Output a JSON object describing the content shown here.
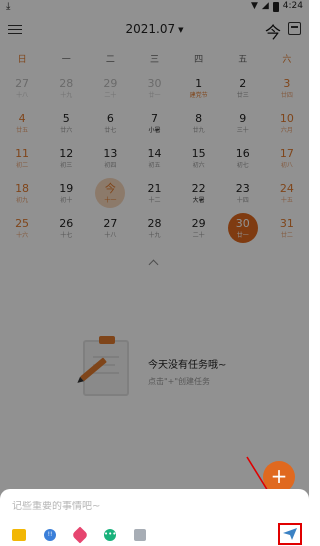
{
  "status_bar": {
    "time": "4:24"
  },
  "header": {
    "month": "2021.07",
    "today_label": "今"
  },
  "weekdays": [
    "日",
    "一",
    "二",
    "三",
    "四",
    "五",
    "六"
  ],
  "calendar": {
    "weeks": [
      [
        {
          "day": "27",
          "sub": "十八"
        },
        {
          "day": "28",
          "sub": "十九"
        },
        {
          "day": "29",
          "sub": "二十"
        },
        {
          "day": "30",
          "sub": "廿一"
        },
        {
          "day": "1",
          "sub": "建党节"
        },
        {
          "day": "2",
          "sub": "廿三"
        },
        {
          "day": "3",
          "sub": "廿四"
        }
      ],
      [
        {
          "day": "4",
          "sub": "廿五"
        },
        {
          "day": "5",
          "sub": "廿六"
        },
        {
          "day": "6",
          "sub": "廿七"
        },
        {
          "day": "7",
          "sub": "小暑"
        },
        {
          "day": "8",
          "sub": "廿九"
        },
        {
          "day": "9",
          "sub": "三十"
        },
        {
          "day": "10",
          "sub": "六月"
        }
      ],
      [
        {
          "day": "11",
          "sub": "初二"
        },
        {
          "day": "12",
          "sub": "初三"
        },
        {
          "day": "13",
          "sub": "初四"
        },
        {
          "day": "14",
          "sub": "初五"
        },
        {
          "day": "15",
          "sub": "初六"
        },
        {
          "day": "16",
          "sub": "初七"
        },
        {
          "day": "17",
          "sub": "初八"
        }
      ],
      [
        {
          "day": "18",
          "sub": "初九"
        },
        {
          "day": "19",
          "sub": "初十"
        },
        {
          "day": "今",
          "sub": "十一"
        },
        {
          "day": "21",
          "sub": "十二"
        },
        {
          "day": "22",
          "sub": "大暑"
        },
        {
          "day": "23",
          "sub": "十四"
        },
        {
          "day": "24",
          "sub": "十五"
        }
      ],
      [
        {
          "day": "25",
          "sub": "十六"
        },
        {
          "day": "26",
          "sub": "十七"
        },
        {
          "day": "27",
          "sub": "十八"
        },
        {
          "day": "28",
          "sub": "十九"
        },
        {
          "day": "29",
          "sub": "二十"
        },
        {
          "day": "30",
          "sub": "廿一"
        },
        {
          "day": "31",
          "sub": "廿二"
        }
      ]
    ]
  },
  "empty_state": {
    "title": "今天没有任务哦~",
    "hint": "点击\"+\"创建任务"
  },
  "fab_label": "+",
  "quick_add": {
    "placeholder": "记些重要的事情吧~",
    "priority_glyph": "!!"
  },
  "colors": {
    "accent": "#e0691f",
    "weekend": "#e07a2e",
    "annotation": "#e00000",
    "send_icon": "#3b82c4"
  }
}
